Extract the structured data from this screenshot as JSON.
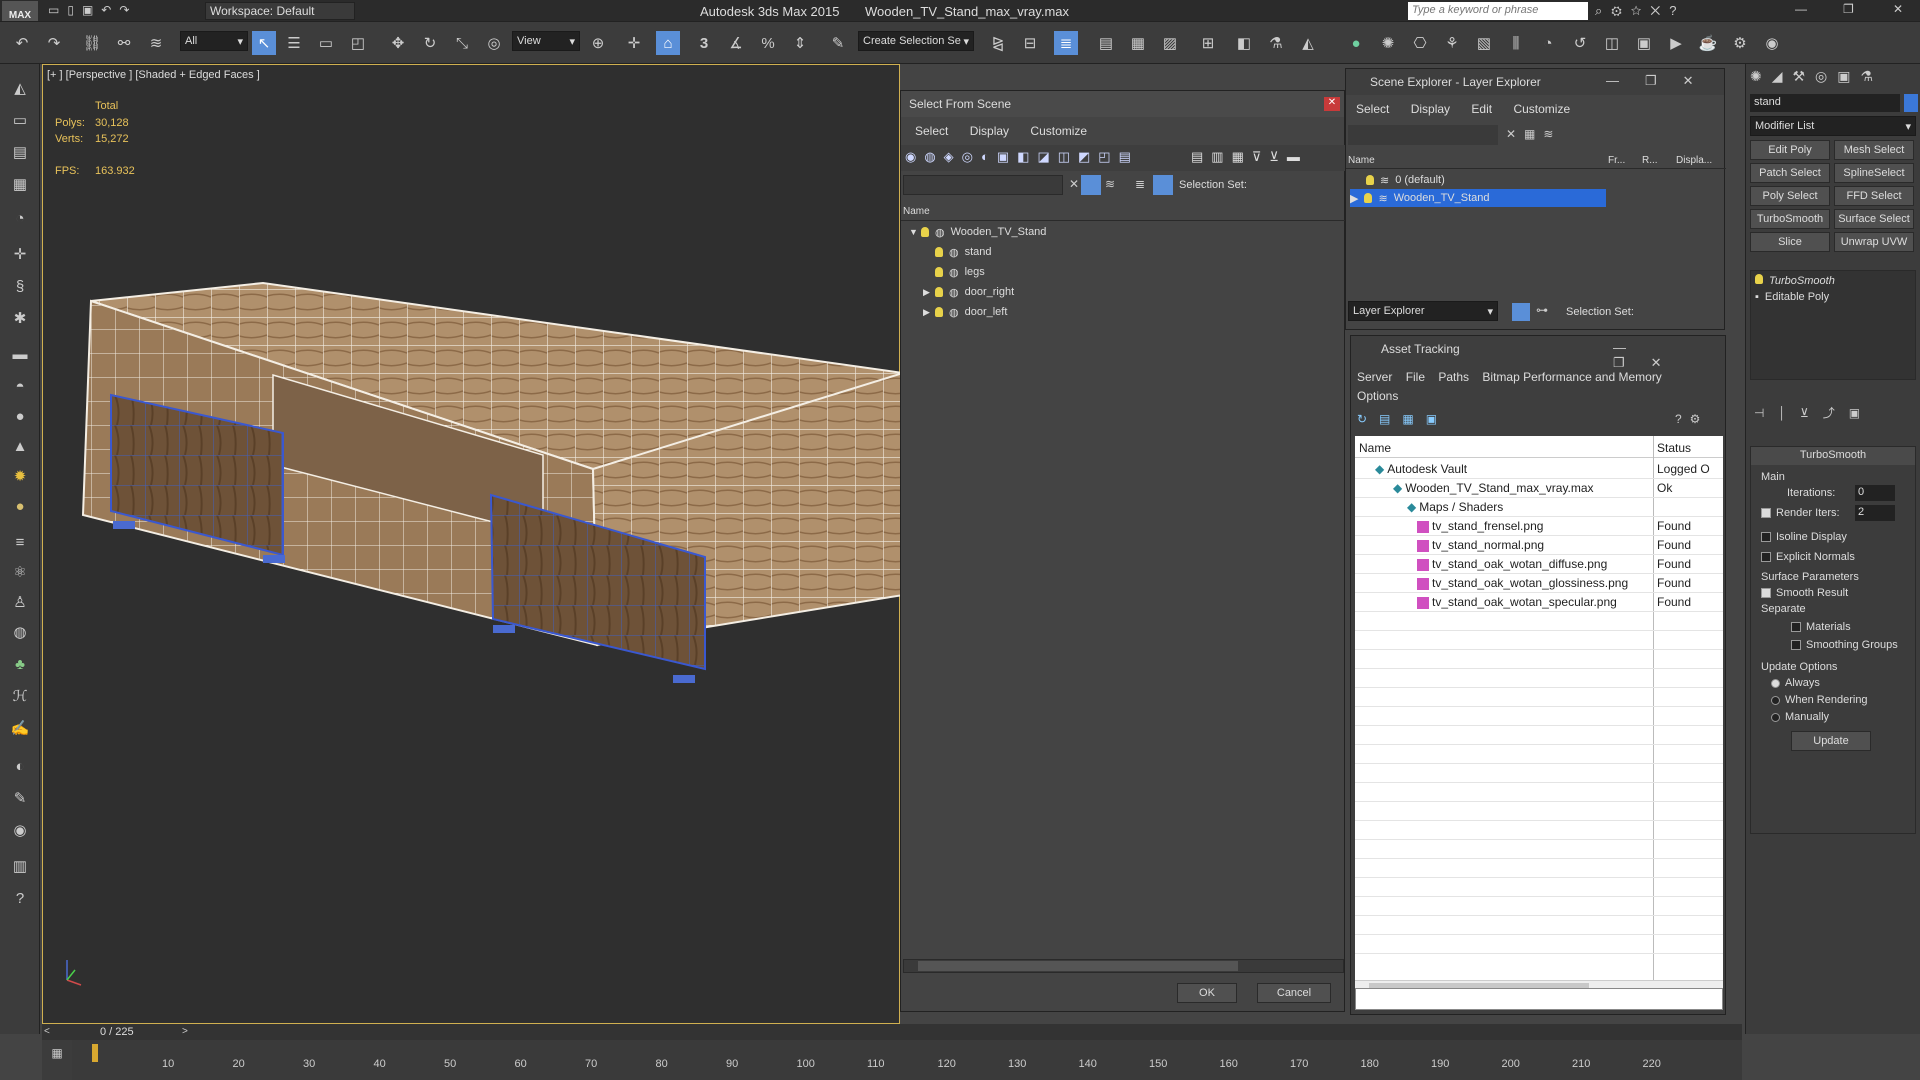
{
  "app": {
    "logo": "MAX",
    "title": "Autodesk 3ds Max  2015",
    "filename": "Wooden_TV_Stand_max_vray.max",
    "workspace": "Workspace: Default",
    "search_placeholder": "Type a keyword or phrase"
  },
  "toolbar": {
    "filter": "All",
    "ref_coord": "View",
    "snap_label": "3",
    "selection_set": "Create Selection Se"
  },
  "viewport": {
    "label": "[+ ] [Perspective ] [Shaded + Edged Faces ]",
    "total_label": "Total",
    "polys_label": "Polys:",
    "polys_value": "30,128",
    "verts_label": "Verts:",
    "verts_value": "15,272",
    "fps_label": "FPS:",
    "fps_value": "163.932"
  },
  "select_from_scene": {
    "title": "Select From Scene",
    "menu": [
      "Select",
      "Display",
      "Customize"
    ],
    "selection_set_label": "Selection Set:",
    "col_name": "Name",
    "tree": [
      {
        "label": "Wooden_TV_Stand",
        "indent": 0,
        "expander": "▼"
      },
      {
        "label": "stand",
        "indent": 1,
        "expander": ""
      },
      {
        "label": "legs",
        "indent": 1,
        "expander": ""
      },
      {
        "label": "door_right",
        "indent": 1,
        "expander": "▶"
      },
      {
        "label": "door_left",
        "indent": 1,
        "expander": "▶"
      }
    ],
    "ok": "OK",
    "cancel": "Cancel"
  },
  "scene_explorer": {
    "title": "Scene Explorer - Layer Explorer",
    "menu": [
      "Select",
      "Display",
      "Edit",
      "Customize"
    ],
    "cols": [
      "Name",
      "Fr...",
      "R...",
      "Displa..."
    ],
    "rows": [
      "0 (default)",
      "Wooden_TV_Stand"
    ],
    "footer_dropdown": "Layer Explorer",
    "selection_set_label": "Selection Set:"
  },
  "asset_tracking": {
    "title": "Asset Tracking",
    "menu": [
      "Server",
      "File",
      "Paths",
      "Bitmap Performance and Memory",
      "Options"
    ],
    "col_name": "Name",
    "col_status": "Status",
    "rows": [
      {
        "name": "Autodesk Vault",
        "status": "Logged O"
      },
      {
        "name": "Wooden_TV_Stand_max_vray.max",
        "status": "Ok"
      },
      {
        "name": "Maps / Shaders",
        "status": ""
      },
      {
        "name": "tv_stand_frensel.png",
        "status": "Found"
      },
      {
        "name": "tv_stand_normal.png",
        "status": "Found"
      },
      {
        "name": "tv_stand_oak_wotan_diffuse.png",
        "status": "Found"
      },
      {
        "name": "tv_stand_oak_wotan_glossiness.png",
        "status": "Found"
      },
      {
        "name": "tv_stand_oak_wotan_specular.png",
        "status": "Found"
      }
    ]
  },
  "command_panel": {
    "object_name": "stand",
    "modifier_list": "Modifier List",
    "buttons": [
      "Edit Poly",
      "Mesh Select",
      "Patch Select",
      "SplineSelect",
      "Poly Select",
      "FFD Select",
      "TurboSmooth",
      "Surface Select",
      "Slice",
      "Unwrap UVW"
    ],
    "stack": [
      "TurboSmooth",
      "Editable Poly"
    ],
    "rollout_title": "TurboSmooth",
    "main_label": "Main",
    "iterations_label": "Iterations:",
    "iterations_value": "0",
    "render_iters_label": "Render Iters:",
    "render_iters_value": "2",
    "isoline": "Isoline Display",
    "explicit_normals": "Explicit Normals",
    "surface_params": "Surface Parameters",
    "smooth_result": "Smooth Result",
    "separate": "Separate",
    "materials": "Materials",
    "smoothing_groups": "Smoothing Groups",
    "update_options": "Update Options",
    "always": "Always",
    "when_rendering": "When Rendering",
    "manually": "Manually",
    "update_btn": "Update"
  },
  "timeline": {
    "frame": "0 / 225",
    "ticks": [
      "10",
      "20",
      "30",
      "40",
      "50",
      "60",
      "70",
      "80",
      "90",
      "100",
      "110",
      "120",
      "130",
      "140",
      "150",
      "160",
      "170",
      "180",
      "190",
      "200",
      "210",
      "220"
    ]
  }
}
